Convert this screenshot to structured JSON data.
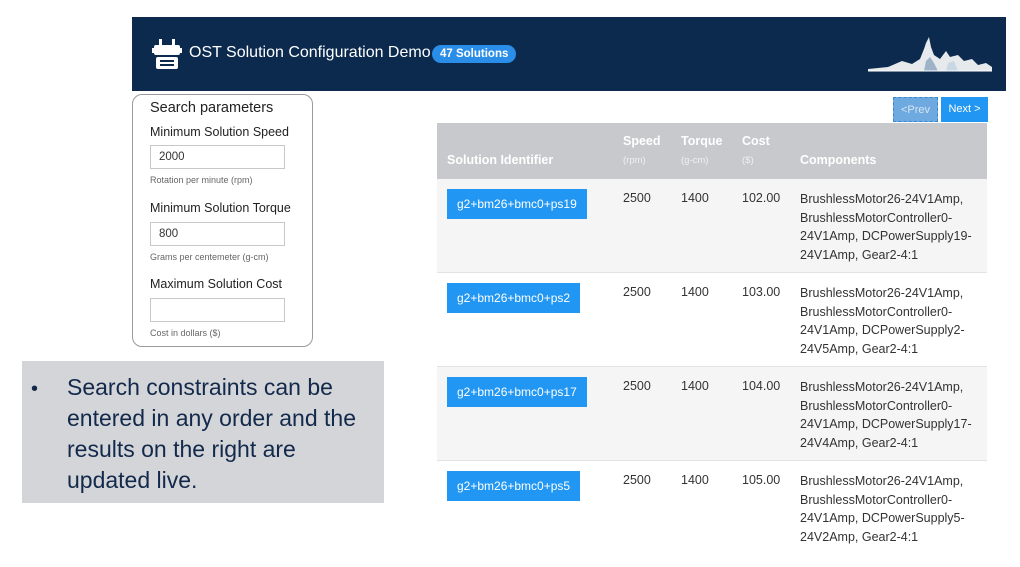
{
  "header": {
    "title": "OST Solution Configuration Demo",
    "badge": "47 Solutions",
    "logo_icon": "robot-icon",
    "skyline_icon": "skyline-icon",
    "bg_color": "#0b2a4e"
  },
  "search": {
    "heading": "Search parameters",
    "speed": {
      "label": "Minimum Solution Speed",
      "value": "2000",
      "help": "Rotation per minute (rpm)"
    },
    "torque": {
      "label": "Minimum Solution Torque",
      "value": "800",
      "help": "Grams per centemeter (g-cm)"
    },
    "cost": {
      "label": "Maximum Solution Cost",
      "value": "",
      "help": "Cost in dollars ($)"
    }
  },
  "callout": {
    "bullet": "•",
    "text": "Search constraints can be entered in any order and the results on the right are updated live."
  },
  "pager": {
    "prev": "<Prev",
    "next": "Next >"
  },
  "table": {
    "headers": {
      "id": "Solution Identifier",
      "speed": "Speed",
      "speed_unit": "(rpm)",
      "torque": "Torque",
      "torque_unit": "(g-cm)",
      "cost": "Cost",
      "cost_unit": "($)",
      "components": "Components"
    },
    "rows": [
      {
        "id": "g2+bm26+bmc0+ps19",
        "speed": "2500",
        "torque": "1400",
        "cost": "102.00",
        "components": "BrushlessMotor26-24V1Amp, BrushlessMotorController0-24V1Amp, DCPowerSupply19-24V1Amp, Gear2-4:1"
      },
      {
        "id": "g2+bm26+bmc0+ps2",
        "speed": "2500",
        "torque": "1400",
        "cost": "103.00",
        "components": "BrushlessMotor26-24V1Amp, BrushlessMotorController0-24V1Amp, DCPowerSupply2-24V5Amp, Gear2-4:1"
      },
      {
        "id": "g2+bm26+bmc0+ps17",
        "speed": "2500",
        "torque": "1400",
        "cost": "104.00",
        "components": "BrushlessMotor26-24V1Amp, BrushlessMotorController0-24V1Amp, DCPowerSupply17-24V4Amp, Gear2-4:1"
      },
      {
        "id": "g2+bm26+bmc0+ps5",
        "speed": "2500",
        "torque": "1400",
        "cost": "105.00",
        "components": "BrushlessMotor26-24V1Amp, BrushlessMotorController0-24V1Amp, DCPowerSupply5-24V2Amp, Gear2-4:1"
      }
    ]
  }
}
